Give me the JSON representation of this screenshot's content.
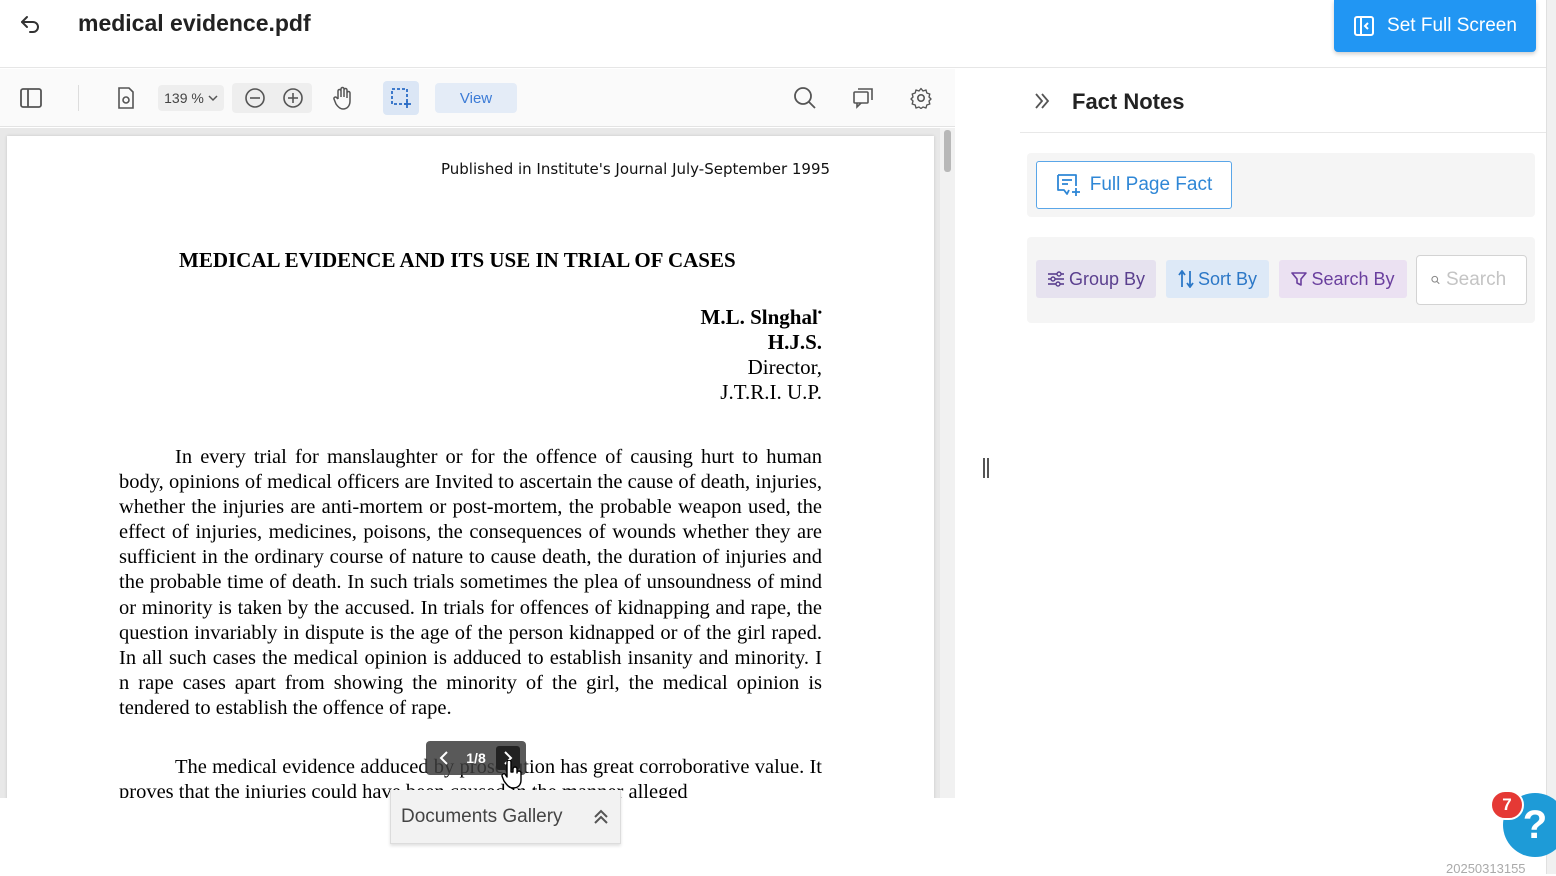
{
  "header": {
    "title": "medical evidence.pdf",
    "fullscreen_label": "Set Full Screen",
    "back_icon": "return-icon"
  },
  "toolbar": {
    "zoom": "139 %",
    "view_label": "View",
    "icons": [
      "sidebar-toggle-icon",
      "document-settings-icon",
      "zoom-out-icon",
      "zoom-in-icon",
      "pan-hand-icon",
      "area-select-icon",
      "search-icon",
      "comments-icon",
      "gear-icon"
    ]
  },
  "document": {
    "published": "Published in Institute's Journal July-September 1995",
    "title": "MEDICAL EVIDENCE AND ITS USE IN TRIAL OF CASES",
    "author_lines": [
      "M.L. Slnghal",
      "H.J.S.",
      "Director,",
      "J.T.R.I. U.P."
    ],
    "author_mark": "•",
    "paragraph1": "In every trial for manslaughter or for the offence of causing hurt to human body, opinions of medical officers are Invited to ascertain the cause of death, injuries, whether the injuries are anti-mortem or post-mortem, the probable weapon used, the effect of injuries, medicines, poisons, the consequences of wounds whether they are sufficient in the ordinary course of nature to cause death, the duration of injuries and the probable time of death. In such trials sometimes the plea of unsoundness of mind or minority is taken by the accused. In trials for offences of kidnapping and rape, the question invariably in dispute is the age of the person kidnapped or of the girl raped. In all such cases the medical opinion is adduced to establish insanity and minority. I n rape cases apart from showing the minority of the girl, the medical opinion is tendered to establish the offence of rape.",
    "paragraph2": "The medical evidence adduced by prosecution has great corroborative value. It proves that the injuries could have been caused in the manner alleged"
  },
  "page_nav": {
    "indicator": "1/8"
  },
  "gallery": {
    "label": "Documents Gallery"
  },
  "fact_panel": {
    "title": "Fact Notes",
    "full_page_label": "Full Page Fact",
    "group_by": "Group By",
    "sort_by": "Sort By",
    "search_by": "Search By",
    "search_placeholder": "Search"
  },
  "help": {
    "badge_count": "7",
    "symbol": "?"
  },
  "footer": {
    "id_text": "2025031315​5"
  },
  "colors": {
    "primary": "#2196f3",
    "accent_blue": "#2f87d6",
    "group_purple": "#5a3f8e",
    "badge_red": "#e53935"
  }
}
